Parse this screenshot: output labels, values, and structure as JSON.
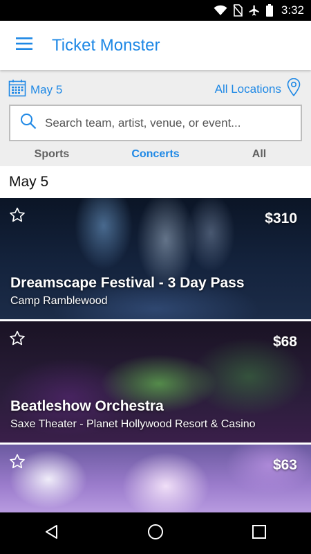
{
  "status_bar": {
    "time": "3:32",
    "icons": [
      "wifi-icon",
      "no-sim-icon",
      "airplane-icon",
      "battery-icon"
    ]
  },
  "app_bar": {
    "title": "Ticket Monster",
    "menu_icon": "menu-icon"
  },
  "filters": {
    "date": "May 5",
    "location": "All Locations",
    "search_placeholder": "Search team, artist, venue, or event...",
    "tabs": [
      {
        "label": "Sports",
        "active": false
      },
      {
        "label": "Concerts",
        "active": true
      },
      {
        "label": "All",
        "active": false
      }
    ]
  },
  "section": {
    "header": "May 5"
  },
  "events": [
    {
      "name": "Dreamscape Festival - 3 Day Pass",
      "venue": "Camp Ramblewood",
      "price": "$310"
    },
    {
      "name": "Beatleshow Orchestra",
      "venue": "Saxe Theater - Planet Hollywood Resort & Casino",
      "price": "$68"
    },
    {
      "name": "",
      "venue": "",
      "price": "$63"
    }
  ],
  "colors": {
    "accent": "#1e88e5",
    "tab_inactive": "#616161",
    "filter_bg": "#eeeeee"
  }
}
